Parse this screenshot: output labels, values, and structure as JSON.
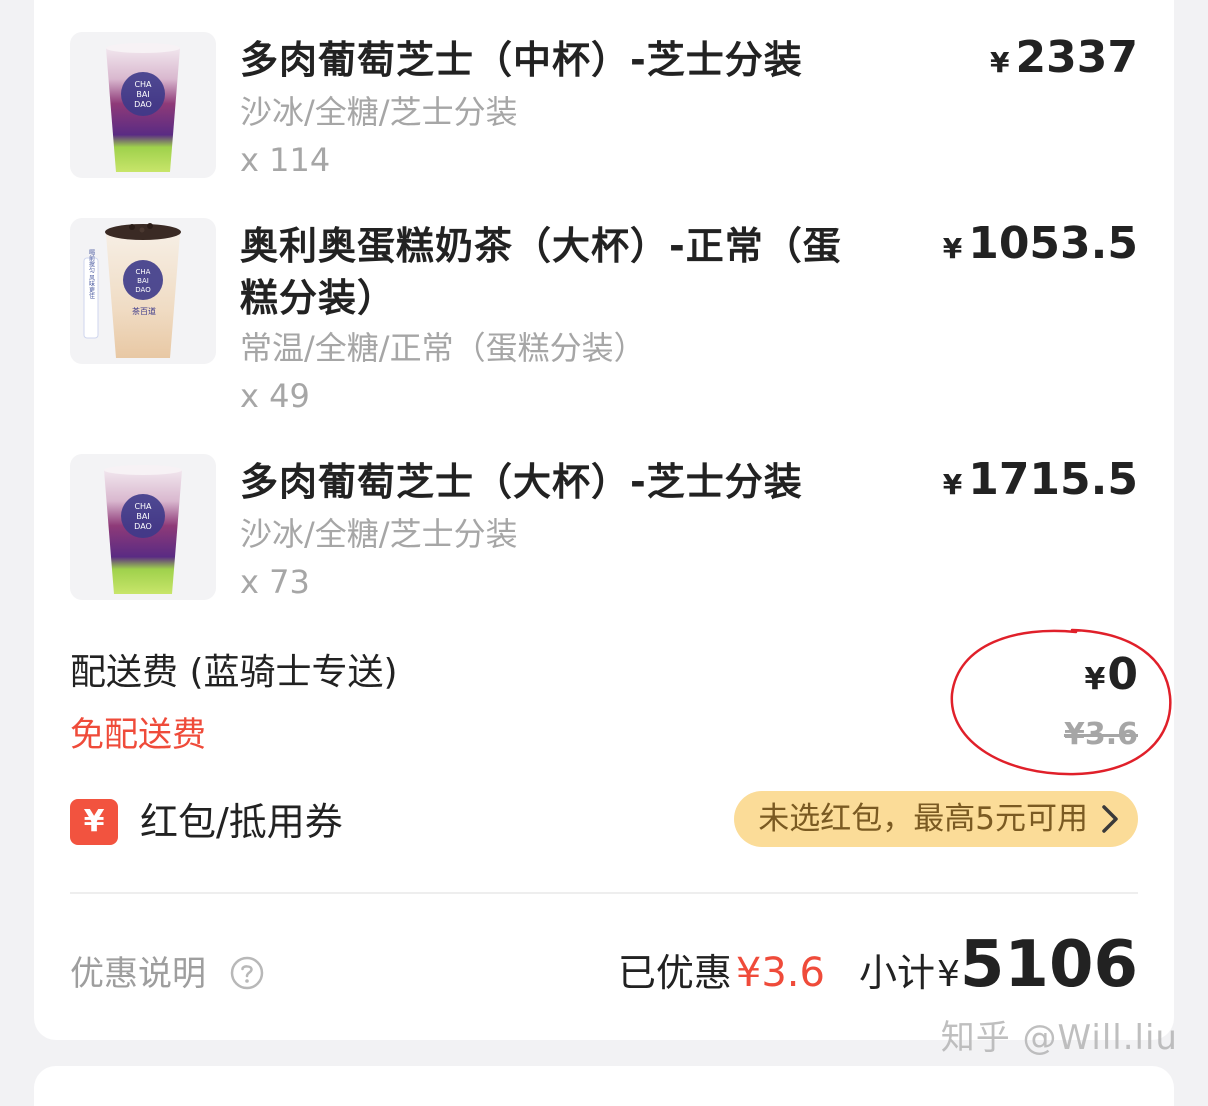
{
  "items": [
    {
      "name": "多肉葡萄芝士（中杯）-芝士分装",
      "spec": "沙冰/全糖/芝士分装",
      "qty": "x 114",
      "currency": "¥",
      "price": "2337"
    },
    {
      "name_line1": "奥利奥蛋糕奶茶（大杯）-正常（蛋",
      "name_line2": "糕分装）",
      "spec": "常温/全糖/正常（蛋糕分装）",
      "qty": "x 49",
      "currency": "¥",
      "price": "1053.5"
    },
    {
      "name": "多肉葡萄芝士（大杯）-芝士分装",
      "spec": "沙冰/全糖/芝士分装",
      "qty": "x 73",
      "currency": "¥",
      "price": "1715.5"
    }
  ],
  "product_images": {
    "cup_brand_line1": "CHA",
    "cup_brand_line2": "BAI",
    "cup_brand_line3": "DAO",
    "side_note": "喝前搅匀 风味更佳",
    "cup_logo": "茶百道"
  },
  "delivery": {
    "label": "配送费 (蓝骑士专送)",
    "free_label": "免配送费",
    "currency": "¥",
    "price": "0",
    "original_price": "¥3.6"
  },
  "coupon": {
    "icon": "yuan-icon",
    "icon_text": "¥",
    "label": "红包/抵用券",
    "hint": "未选红包，最高5元可用"
  },
  "summary": {
    "promo_note": "优惠说明",
    "saved_label": "已优惠",
    "saved_value": "¥3.6",
    "subtotal_label": "小计",
    "subtotal_currency": "¥",
    "subtotal_value": "5106"
  },
  "watermark": "知乎 @Will.liu",
  "colors": {
    "accent_red": "#ef4b3a",
    "coupon_pill": "#fbdc98",
    "muted_text": "#a6a6a6",
    "annotation_circle": "#e0202a"
  }
}
